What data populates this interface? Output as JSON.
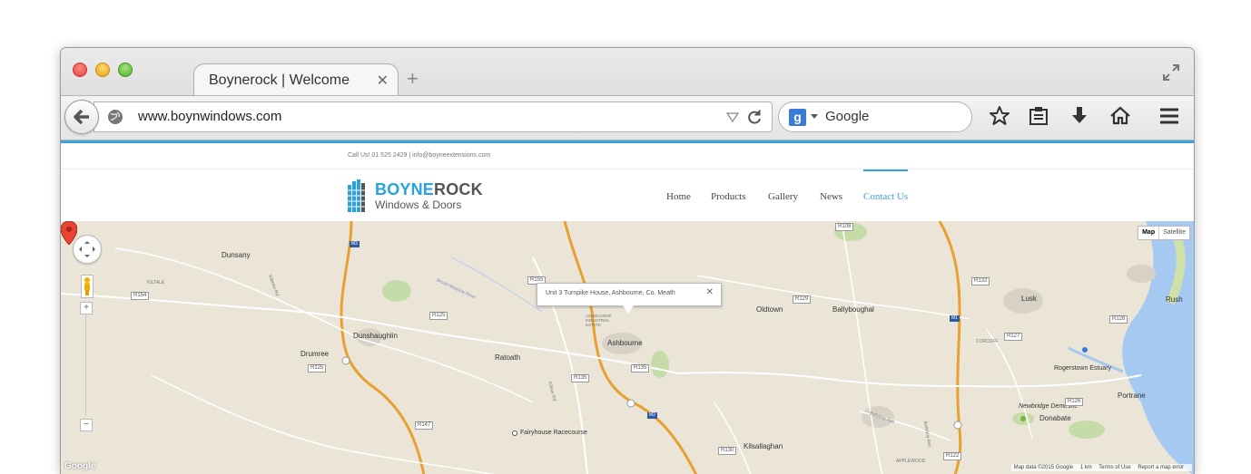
{
  "browser": {
    "tab_title": "Boynerock | Welcome",
    "tab_close": "✕",
    "new_tab": "+",
    "url": "www.boynwindows.com",
    "search_engine_letter": "g",
    "search_placeholder": "Google",
    "toolbar_icons": [
      "star-icon",
      "reading-list-icon",
      "download-icon",
      "home-icon",
      "menu-icon"
    ]
  },
  "site": {
    "topbar": "Call Us! 01 525 2429  |  info@boyneextensions.com",
    "logo": {
      "part1": "BOYNE",
      "part2": "ROCK",
      "subtitle": "Windows & Doors"
    },
    "nav": [
      "Home",
      "Products",
      "Gallery",
      "News",
      "Contact Us"
    ],
    "active_nav": "Contact Us",
    "accent_color": "#3aa3dd"
  },
  "map": {
    "map_type": [
      "Map",
      "Satellite"
    ],
    "zoom_in": "+",
    "zoom_out": "−",
    "info_window": "Unit 3 Turnpike House, Ashbourne, Co. Meath",
    "info_close": "✕",
    "google_logo": "Google",
    "attribution": [
      "Map data ©2015 Google",
      "1 km",
      "Terms of Use",
      "Report a map error"
    ],
    "places": [
      "Dunsany",
      "KILTALE",
      "Dunshaughlin",
      "Drumree",
      "Ratoath",
      "ASHBOURNE INDUSTRIAL ESTATE",
      "Ashbourne",
      "Fairyhouse Racecourse",
      "Oldtown",
      "Ballyboughal",
      "Kilsallaghan",
      "Lusk",
      "Rush",
      "CORDUFF",
      "Rogerstown Estuary",
      "Portrane",
      "Newbridge Demesne",
      "Donabate",
      "APPLEWOOD"
    ],
    "roads": [
      "M3",
      "R154",
      "R125",
      "R155",
      "R135",
      "R147",
      "M2",
      "R130",
      "R108",
      "R129",
      "R132",
      "R128",
      "R127",
      "R126",
      "M1",
      "R122",
      "R135",
      "R125"
    ],
    "road_names": [
      "Kilbrew Rd",
      "Broad Meadow River",
      "Killrue Rd",
      "Ballyboy Ave",
      "Ballyboy Ave"
    ]
  }
}
